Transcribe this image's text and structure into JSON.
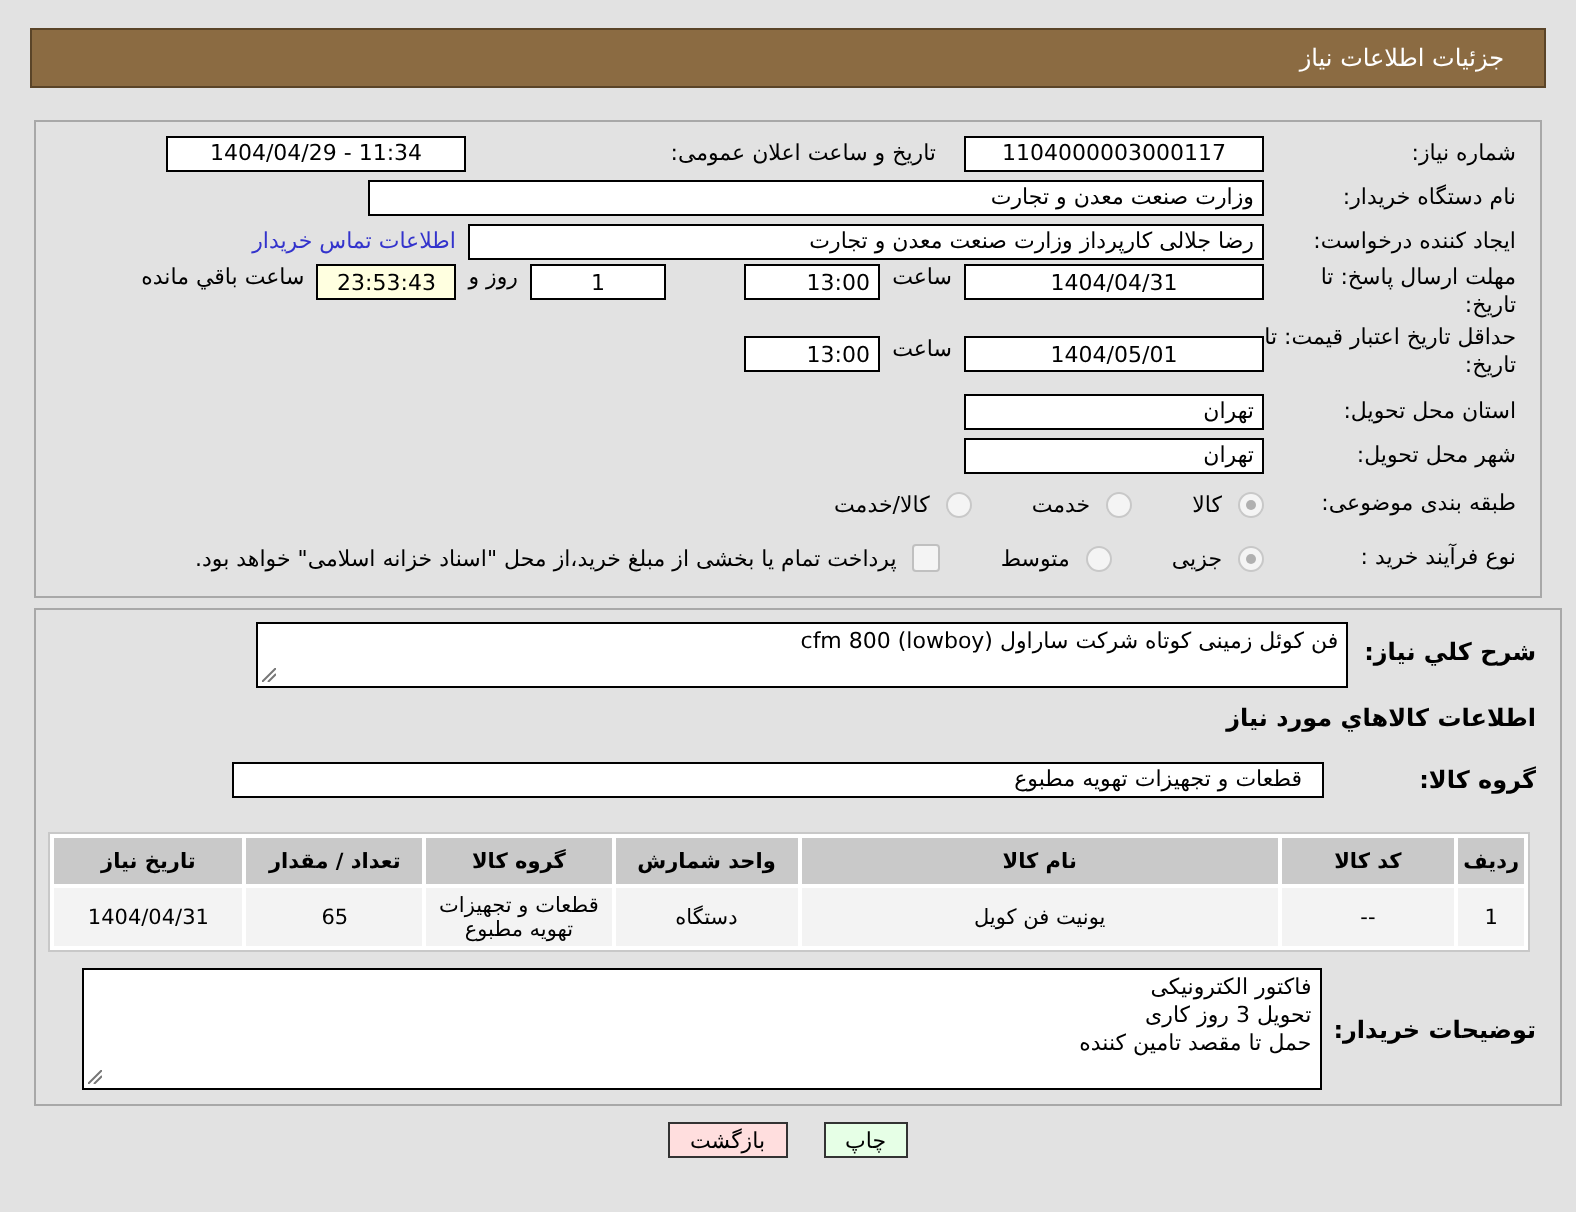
{
  "header": {
    "title": "جزئیات اطلاعات نیاز"
  },
  "details": {
    "need_number": {
      "label": "شماره نیاز:",
      "value": "1104000003000117"
    },
    "announce": {
      "label": "تاریخ و ساعت اعلان عمومی:",
      "value": "1404/04/29 - 11:34"
    },
    "buyer_org": {
      "label": "نام دستگاه خریدار:",
      "value": "وزارت صنعت معدن و تجارت"
    },
    "creator": {
      "label": "ایجاد کننده درخواست:",
      "value": "رضا جلالی کارپرداز وزارت صنعت معدن و تجارت",
      "link": "اطلاعات تماس خریدار"
    },
    "reply_deadline": {
      "label": "مهلت ارسال پاسخ: تا تاریخ:",
      "date": "1404/04/31",
      "time_label": "ساعت",
      "time": "13:00",
      "days": "1",
      "days_label": "روز و",
      "remaining": "23:53:43",
      "remaining_label": "ساعت باقي مانده"
    },
    "price_validity": {
      "label": "حداقل تاریخ اعتبار قیمت: تا تاریخ:",
      "date": "1404/05/01",
      "time_label": "ساعت",
      "time": "13:00"
    },
    "province": {
      "label": "استان محل تحویل:",
      "value": "تهران"
    },
    "city": {
      "label": "شهر محل تحویل:",
      "value": "تهران"
    },
    "category": {
      "label": "طبقه بندی موضوعی:",
      "options": [
        {
          "label": "کالا",
          "selected": true
        },
        {
          "label": "خدمت",
          "selected": false
        },
        {
          "label": "کالا/خدمت",
          "selected": false
        }
      ]
    },
    "process": {
      "label": "نوع فرآیند خرید :",
      "options": [
        {
          "label": "جزیی",
          "selected": true
        },
        {
          "label": "متوسط",
          "selected": false
        }
      ],
      "treasury": {
        "label": "پرداخت تمام یا بخشی از مبلغ خرید،از محل \"اسناد خزانه اسلامی\" خواهد بود.",
        "checked": false
      }
    }
  },
  "summary": {
    "label": "شرح كلي نياز:",
    "value": "فن کوئل زمینی کوتاه شرکت ساراول cfm 800 (lowboy)"
  },
  "goods": {
    "title": "اطلاعات كالاهاي مورد نياز",
    "group_label": "گروه کالا:",
    "group_value": "قطعات و تجهیزات تهویه مطبوع",
    "columns": [
      "ردیف",
      "کد کالا",
      "نام کالا",
      "واحد شمارش",
      "گروه کالا",
      "تعداد / مقدار",
      "تاریخ نیاز"
    ],
    "rows": [
      [
        "1",
        "--",
        "یونیت فن کویل",
        "دستگاه",
        "قطعات و تجهیزات تهویه مطبوع",
        "65",
        "1404/04/31"
      ]
    ]
  },
  "notes": {
    "label": "توضیحات خریدار:",
    "lines": [
      "فاکتور الکترونیکی",
      "تحویل 3 روز کاری",
      "حمل تا مقصد تامین کننده"
    ]
  },
  "buttons": [
    {
      "label": "چاپ",
      "kind": "print"
    },
    {
      "label": "بازگشت",
      "kind": "back"
    }
  ]
}
